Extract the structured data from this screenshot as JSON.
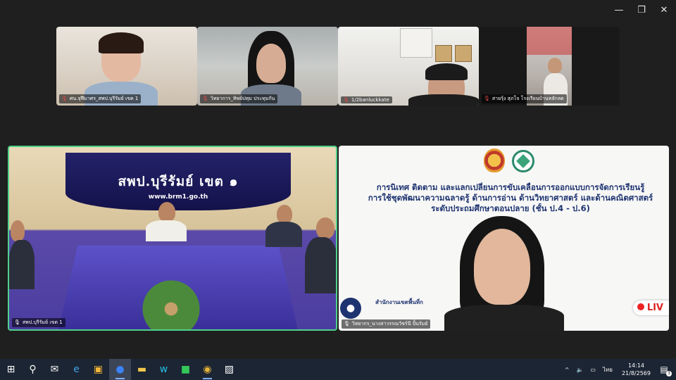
{
  "window": {
    "minimize_glyph": "—",
    "restore_glyph": "❐",
    "close_glyph": "✕"
  },
  "participants_top": [
    {
      "name": "ศน.จุฬีมาศร_สพป.บุรีรัมย์ เขต 1",
      "muted": true
    },
    {
      "name": "วิทยาการ_ทิพย์ปทุม ประทุมกัน",
      "muted": true
    },
    {
      "name": "1/2banluckkate",
      "muted": true
    },
    {
      "name": "สายรุ้ง สุภโจ โรงเรียนบ้านหลักลด",
      "muted": true
    }
  ],
  "main_left": {
    "name": "สพป.บุรีรัมย์ เขต 1",
    "banner_title": "สพป.บุรีรัมย์ เขต ๑",
    "banner_url": "www.brm1.go.th"
  },
  "main_right": {
    "name": "วิทยากร_นางสาวรรณวัชร์นี ปั้นรัมย์",
    "slide_line1": "การนิเทศ ติดตาม และแลกเปลี่ยนการขับเคลื่อนการออกแบบการจัดการเรียนรู้",
    "slide_line2": "การใช้ชุดพัฒนาความฉลาดรู้ ด้านการอ่าน ด้านวิทยาศาสตร์ และด้านคณิตศาสตร์",
    "slide_line3": "ระดับประถมศึกษาตอนปลาย (ชั้น ป.4 - ป.6)",
    "office_text": "สำนักงานเขตพื้นที่ก",
    "live_label": "LIV"
  },
  "taskbar": {
    "apps": [
      "start-icon",
      "search-icon",
      "mail-icon",
      "edge-icon",
      "store-icon",
      "zoom-icon",
      "files-icon",
      "webex-icon",
      "line-icon",
      "chrome-icon",
      "photos-icon"
    ],
    "clock_time": "14:14",
    "clock_date": "21/8/2569",
    "lang": "ไทย",
    "notification_count": "3"
  },
  "colors": {
    "active_speaker_border": "#4fd18b",
    "taskbar_bg": "#1c2533"
  }
}
